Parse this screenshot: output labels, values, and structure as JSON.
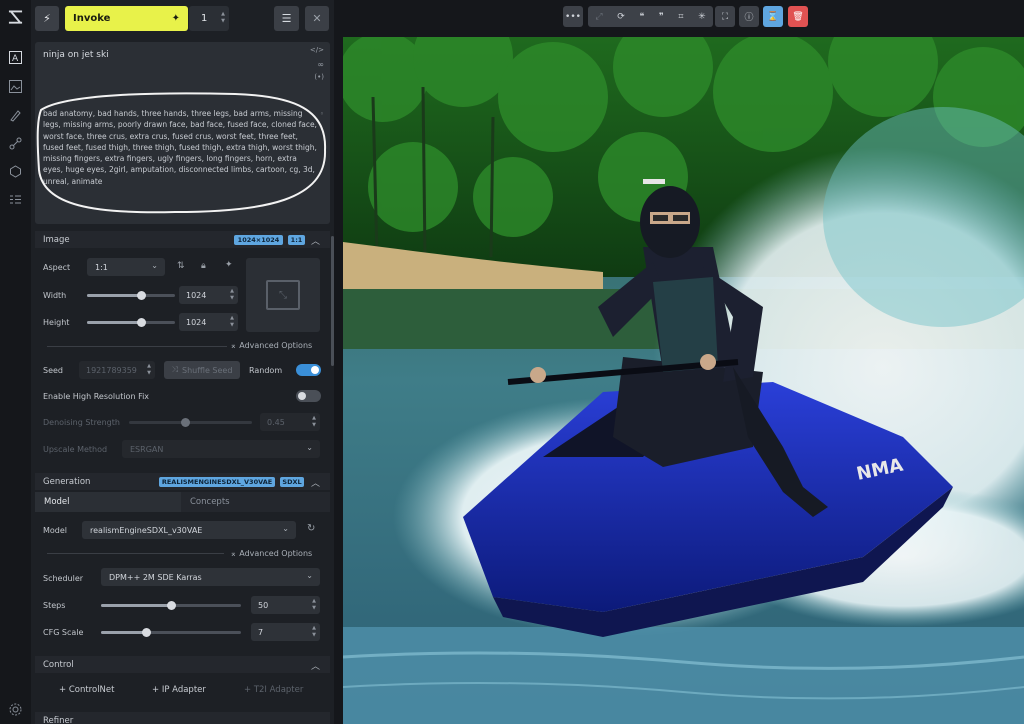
{
  "colors": {
    "accent_yellow": "#e8f24a",
    "accent_blue": "#5fa6e0",
    "danger_red": "#e05252",
    "panel_bg": "#1d2025"
  },
  "toolbar_left": {
    "invoke_label": "Invoke",
    "iterations": "1"
  },
  "prompts": {
    "positive": "ninja on jet ski",
    "negative": "bad anatomy, bad hands, three hands, three legs, bad arms, missing legs, missing arms, poorly drawn face, bad face, fused face, cloned face, worst face, three crus, extra crus, fused crus, worst feet, three feet, fused feet, fused thigh, three thigh, fused thigh, extra thigh, worst thigh, missing fingers, extra fingers, ugly fingers, long fingers, horn, extra eyes, huge eyes, 2girl, amputation, disconnected limbs, cartoon, cg, 3d, unreal, animate"
  },
  "image_section": {
    "title": "Image",
    "size_badge": "1024×1024",
    "ratio_badge": "1:1",
    "aspect_label": "Aspect",
    "aspect_value": "1:1",
    "width_label": "Width",
    "width_value": "1024",
    "height_label": "Height",
    "height_value": "1024",
    "advanced_label": "Advanced Options",
    "seed_label": "Seed",
    "seed_value": "1921789359",
    "shuffle_label": "Shuffle Seed",
    "random_label": "Random",
    "random_on": true,
    "hires_label": "Enable High Resolution Fix",
    "hires_on": false,
    "denoise_label": "Denoising Strength",
    "denoise_value": "0.45",
    "upscale_label": "Upscale Method",
    "upscale_value": "ESRGAN"
  },
  "generation_section": {
    "title": "Generation",
    "model_badge": "REALISMENGINESDXL_V30VAE",
    "arch_badge": "SDXL",
    "tab_model": "Model",
    "tab_concepts": "Concepts",
    "model_label": "Model",
    "model_value": "realismEngineSDXL_v30VAE",
    "advanced_label": "Advanced Options",
    "scheduler_label": "Scheduler",
    "scheduler_value": "DPM++ 2M SDE Karras",
    "steps_label": "Steps",
    "steps_value": "50",
    "cfg_label": "CFG Scale",
    "cfg_value": "7"
  },
  "control_section": {
    "title": "Control",
    "controlnet_label": "ControlNet",
    "ip_adapter_label": "IP Adapter",
    "t2i_adapter_label": "T2I Adapter"
  },
  "refiner_section": {
    "title": "Refiner"
  },
  "canvas_toolbar": {
    "icons": [
      "more-icon",
      "expand-arrows-icon",
      "remix-icon",
      "quote-icon",
      "asterisk-icon",
      "ruler-icon",
      "sparkle-icon",
      "fullscreen-icon",
      "info-icon",
      "hourglass-icon",
      "trash-icon"
    ]
  }
}
